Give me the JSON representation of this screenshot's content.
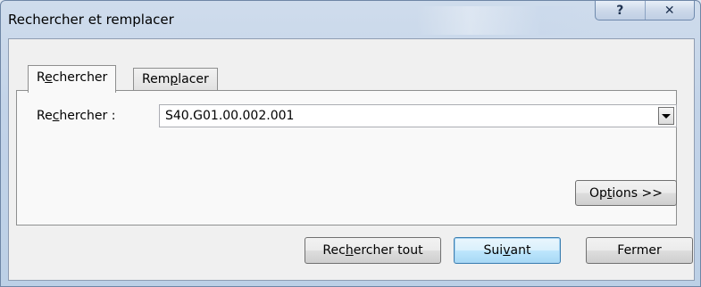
{
  "window": {
    "title": "Rechercher et remplacer",
    "help_glyph": "?",
    "close_glyph": "✕"
  },
  "tabs": [
    {
      "pre": "R",
      "ul": "e",
      "post": "chercher",
      "active": true
    },
    {
      "pre": "Rem",
      "ul": "p",
      "post": "lacer",
      "active": false
    }
  ],
  "find": {
    "label_pre": "Re",
    "label_ul": "c",
    "label_post": "hercher :",
    "value": "S40.G01.00.002.001"
  },
  "buttons": {
    "options": {
      "pre": "Op",
      "ul": "t",
      "post": "ions >>"
    },
    "find_all": {
      "pre": "Rec",
      "ul": "h",
      "post": "ercher tout"
    },
    "next": {
      "pre": "Sui",
      "ul": "v",
      "post": "ant"
    },
    "close": {
      "label": "Fermer"
    }
  }
}
